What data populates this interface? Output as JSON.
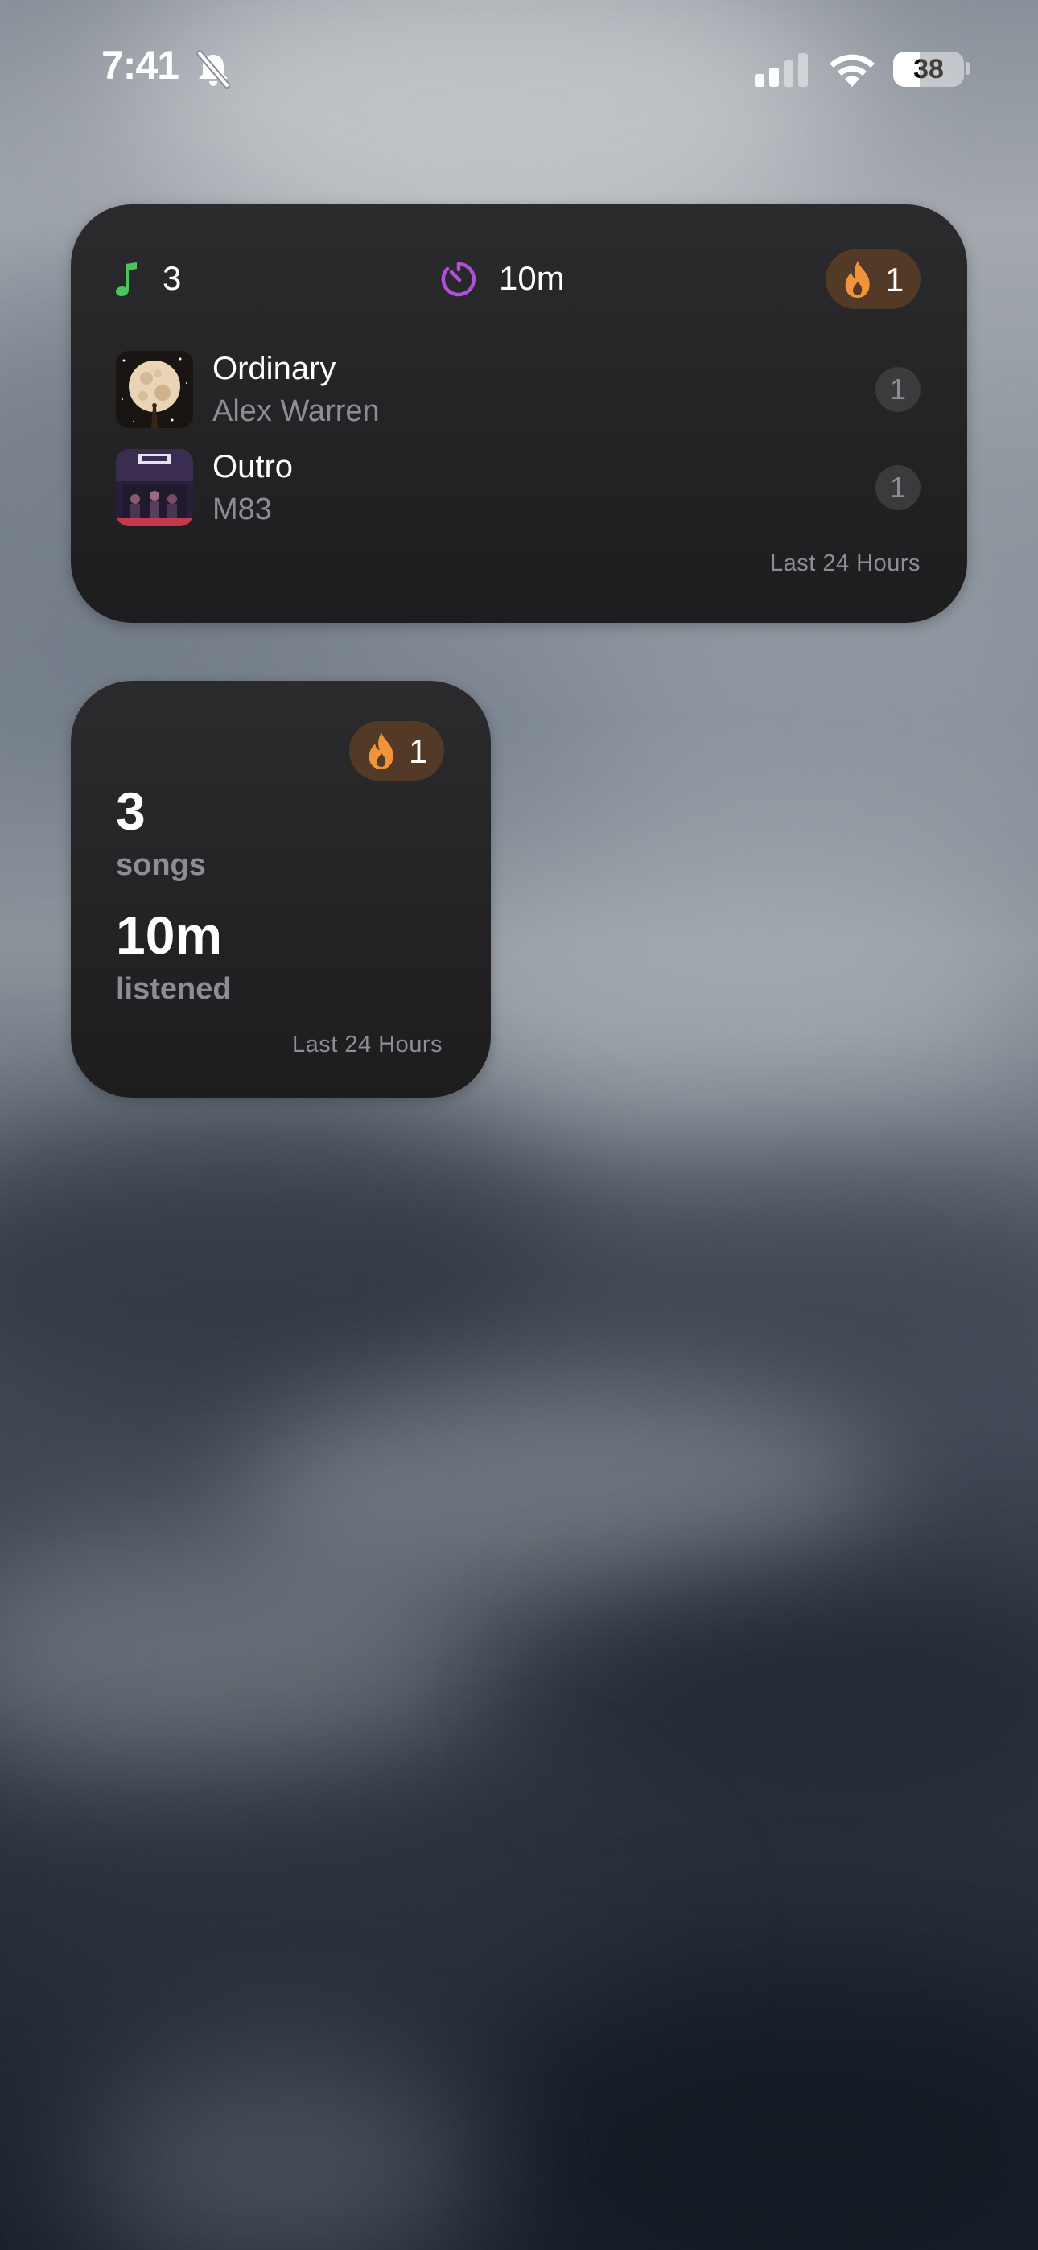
{
  "status_bar": {
    "time": "7:41",
    "silent_icon": "bell-slash-icon",
    "signal_icon": "cellular-signal-icon",
    "wifi_icon": "wifi-icon",
    "battery_level": "38",
    "battery_fraction": 0.38
  },
  "widget_medium": {
    "songs_count": "3",
    "songs_icon": "music-note-icon",
    "time_listened": "10m",
    "time_icon": "timer-icon",
    "streak": "1",
    "streak_icon": "flame-icon",
    "tracks": [
      {
        "title": "Ordinary",
        "artist": "Alex Warren",
        "plays": "1",
        "art_icon": "album-art-moon"
      },
      {
        "title": "Outro",
        "artist": "M83",
        "plays": "1",
        "art_icon": "album-art-m83"
      }
    ],
    "period": "Last 24 Hours"
  },
  "widget_small": {
    "streak": "1",
    "songs_count": "3",
    "songs_label": "songs",
    "time_listened": "10m",
    "time_label": "listened",
    "period": "Last 24 Hours"
  },
  "colors": {
    "widget_bg": "#1f1f21",
    "streak_badge": "#533a26",
    "flame": "#f0943a",
    "music_note": "#4cc35b",
    "timer": "#b14fd6",
    "secondary_text": "#8d8d92"
  }
}
